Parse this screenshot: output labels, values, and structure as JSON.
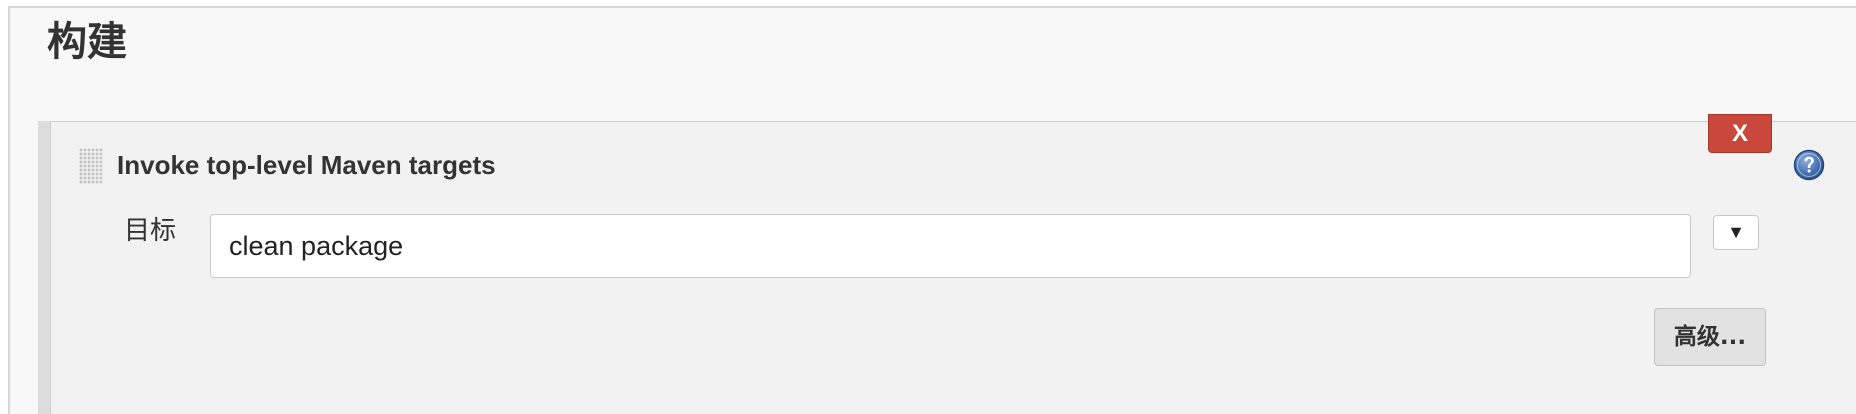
{
  "section": {
    "title": "构建"
  },
  "build_step": {
    "title": "Invoke top-level Maven targets",
    "delete_label": "X",
    "help_icon": "help-icon",
    "goals": {
      "label": "目标",
      "value": "clean package"
    },
    "expand_symbol": "▼",
    "advanced_label": "高级..."
  },
  "colors": {
    "delete_button": "#c9483b",
    "help_icon": "#3f67a8",
    "panel_background": "#f2f2f2",
    "page_background": "#f8f8f8"
  }
}
